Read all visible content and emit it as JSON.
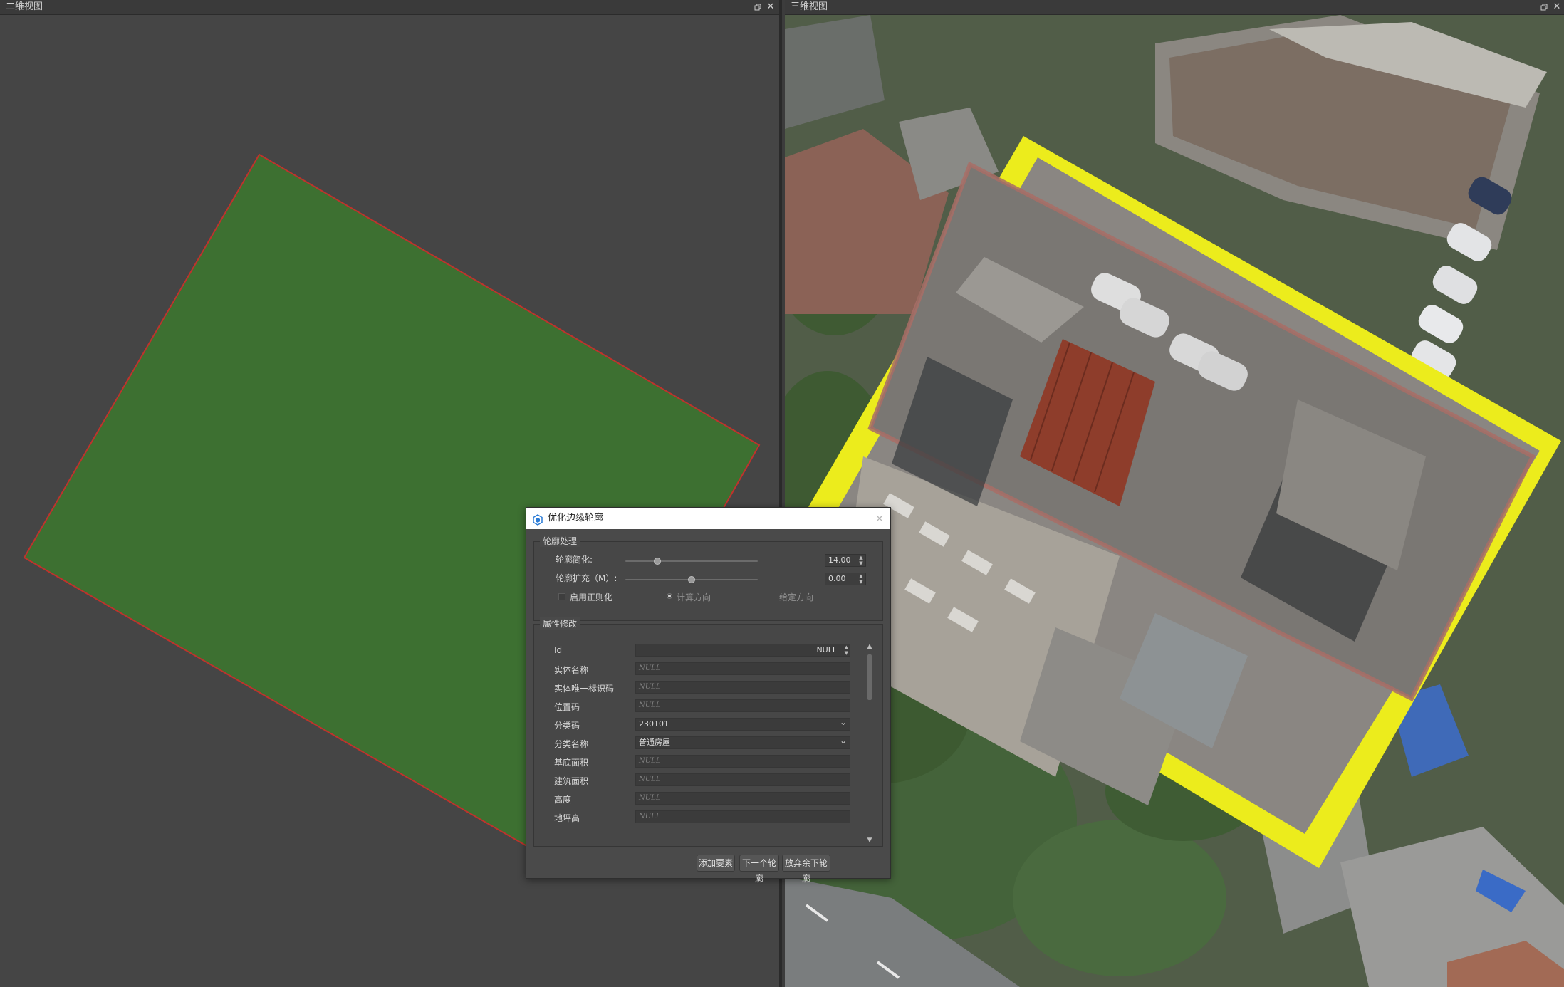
{
  "panels": {
    "view2d": {
      "title": "二维视图",
      "restore_icon": "restore-icon",
      "close_icon": "close-icon"
    },
    "view3d": {
      "title": "三维视图",
      "restore_icon": "restore-icon",
      "close_icon": "close-icon"
    }
  },
  "colors": {
    "polygon_fill": "#3d7031",
    "polygon_stroke": "#c0322c",
    "highlight_outline": "#ecec1c",
    "panel_bg": "#454545"
  },
  "dialog": {
    "title": "优化边缘轮廓",
    "outline_group": {
      "title": "轮廓处理",
      "simplify_label": "轮廓简化:",
      "simplify_value": "14.00",
      "simplify_level": 0.24,
      "expand_label": "轮廓扩充（M）:",
      "expand_value": "0.00",
      "expand_level": 0.5,
      "regularize_label": "启用正则化",
      "regularize_checked": false,
      "calc_direction_label": "计算方向",
      "fixed_direction_label": "给定方向"
    },
    "attr_group": {
      "title": "属性修改",
      "fields": [
        {
          "label": "Id",
          "value": "NULL",
          "kind": "number"
        },
        {
          "label": "实体名称",
          "value": "NULL",
          "kind": "placeholder"
        },
        {
          "label": "实体唯一标识码",
          "value": "NULL",
          "kind": "placeholder"
        },
        {
          "label": "位置码",
          "value": "NULL",
          "kind": "placeholder"
        },
        {
          "label": "分类码",
          "value": "230101",
          "kind": "combo"
        },
        {
          "label": "分类名称",
          "value": "普通房屋",
          "kind": "combo"
        },
        {
          "label": "基底面积",
          "value": "NULL",
          "kind": "placeholder"
        },
        {
          "label": "建筑面积",
          "value": "NULL",
          "kind": "placeholder"
        },
        {
          "label": "高度",
          "value": "NULL",
          "kind": "placeholder"
        },
        {
          "label": "地坪高",
          "value": "NULL",
          "kind": "placeholder"
        }
      ]
    },
    "buttons": {
      "add": "添加要素",
      "next": "下一个轮廓",
      "discard": "放弃余下轮廓"
    }
  }
}
